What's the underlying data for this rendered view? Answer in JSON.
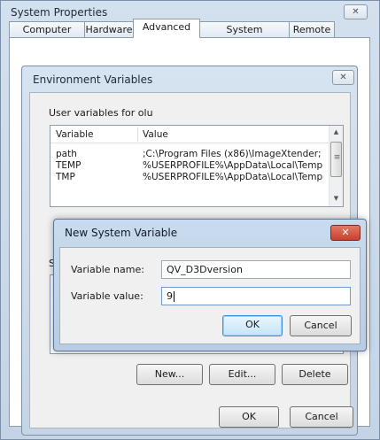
{
  "system_properties": {
    "title": "System Properties",
    "close_glyph": "✕",
    "tabs": [
      {
        "label": "Computer Name"
      },
      {
        "label": "Hardware"
      },
      {
        "label": "Advanced"
      },
      {
        "label": "System Protection"
      },
      {
        "label": "Remote"
      }
    ],
    "active_tab": "Advanced"
  },
  "env_vars": {
    "title": "Environment Variables",
    "close_glyph": "✕",
    "user_group_label": "User variables for olu",
    "columns": [
      "Variable",
      "Value"
    ],
    "rows": [
      {
        "variable": "path",
        "value": ";C:\\Program Files (x86)\\ImageXtender;"
      },
      {
        "variable": "TEMP",
        "value": "%USERPROFILE%\\AppData\\Local\\Temp"
      },
      {
        "variable": "TMP",
        "value": "%USERPROFILE%\\AppData\\Local\\Temp"
      }
    ],
    "system_group_label_partial": "S",
    "new_label": "New...",
    "edit_label": "Edit...",
    "delete_label": "Delete",
    "ok_label": "OK",
    "cancel_label": "Cancel"
  },
  "new_var": {
    "title": "New System Variable",
    "close_glyph": "✕",
    "name_label": "Variable name:",
    "name_value": "QV_D3Dversion",
    "value_label": "Variable value:",
    "value_value": "9",
    "ok_label": "OK",
    "cancel_label": "Cancel"
  },
  "icons": {
    "scroll_up": "▲",
    "scroll_down": "▼",
    "grip": "≡"
  },
  "colors": {
    "titlebar_blue": "#c5d6ea",
    "close_red": "#c8402e",
    "focus_blue": "#3a8ee6"
  }
}
